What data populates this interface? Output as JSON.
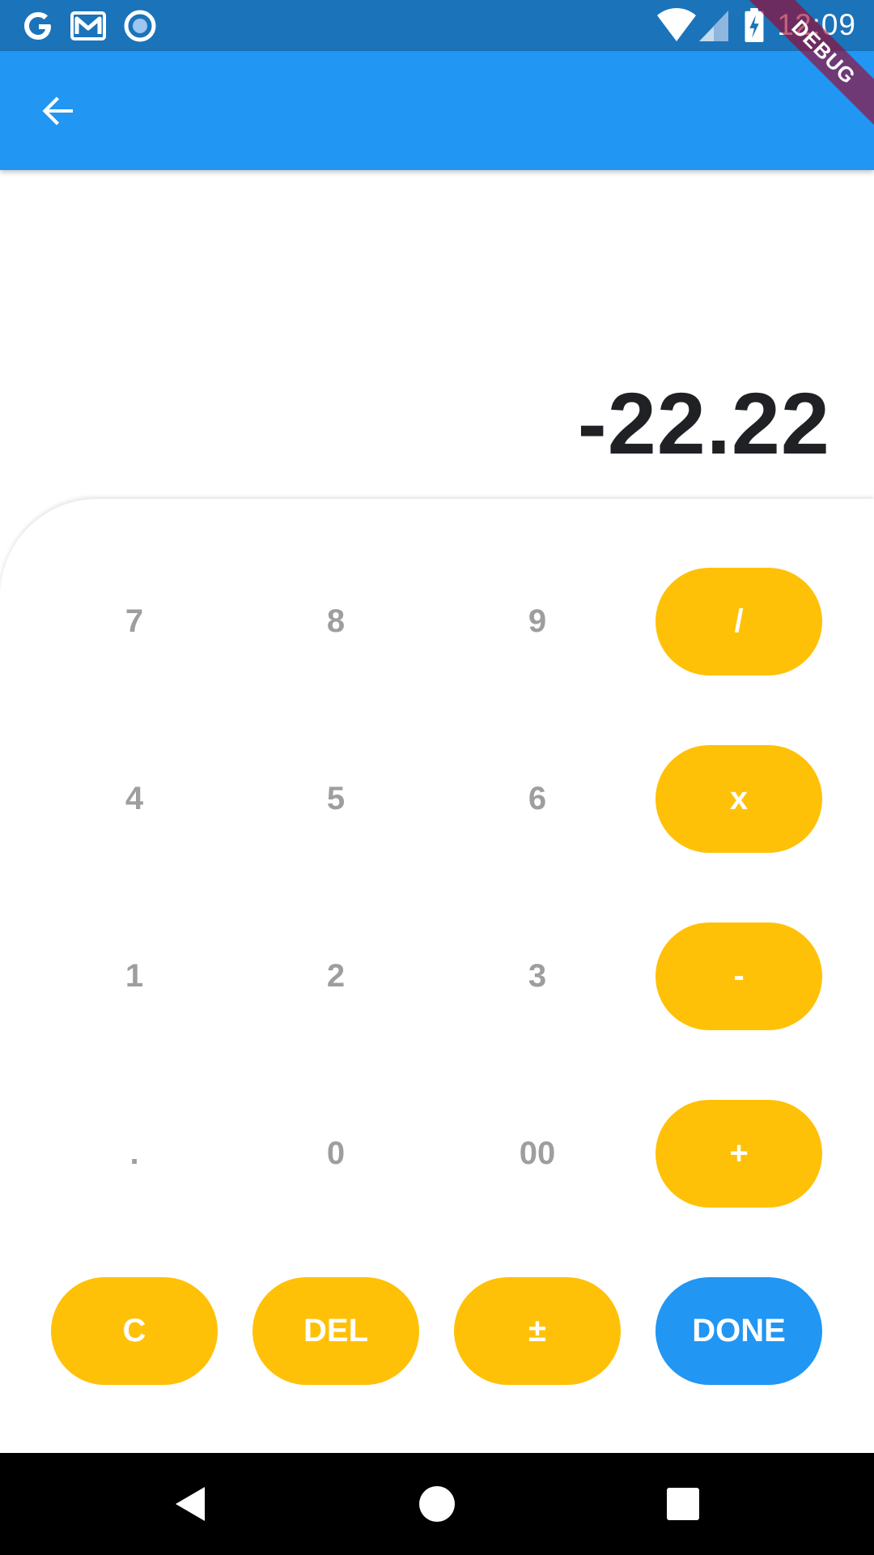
{
  "status_bar": {
    "time": "12:09",
    "notification_icons": [
      "google-g-icon",
      "gmail-icon",
      "circle-app-icon"
    ],
    "system_icons": [
      "wifi-icon",
      "cellular-signal-icon",
      "battery-charging-icon"
    ]
  },
  "debug_banner": "DEBUG",
  "app_bar": {
    "back_icon": "arrow-back-icon"
  },
  "display": {
    "value": "-22.22"
  },
  "keypad": {
    "rows": [
      [
        "7",
        "8",
        "9",
        "/"
      ],
      [
        "4",
        "5",
        "6",
        "x"
      ],
      [
        "1",
        "2",
        "3",
        "-"
      ],
      [
        ".",
        "0",
        "00",
        "+"
      ]
    ],
    "actions": [
      "C",
      "DEL",
      "±",
      "DONE"
    ]
  },
  "nav_bar": {
    "icons": [
      "back-triangle-icon",
      "home-circle-icon",
      "recents-square-icon"
    ]
  },
  "colors": {
    "status_bar": "#1b73ba",
    "app_bar": "#2196f3",
    "operator_key": "#ffc107",
    "done_key": "#2196f3",
    "digit_text": "#9e9e9e",
    "display_text": "#202124"
  }
}
